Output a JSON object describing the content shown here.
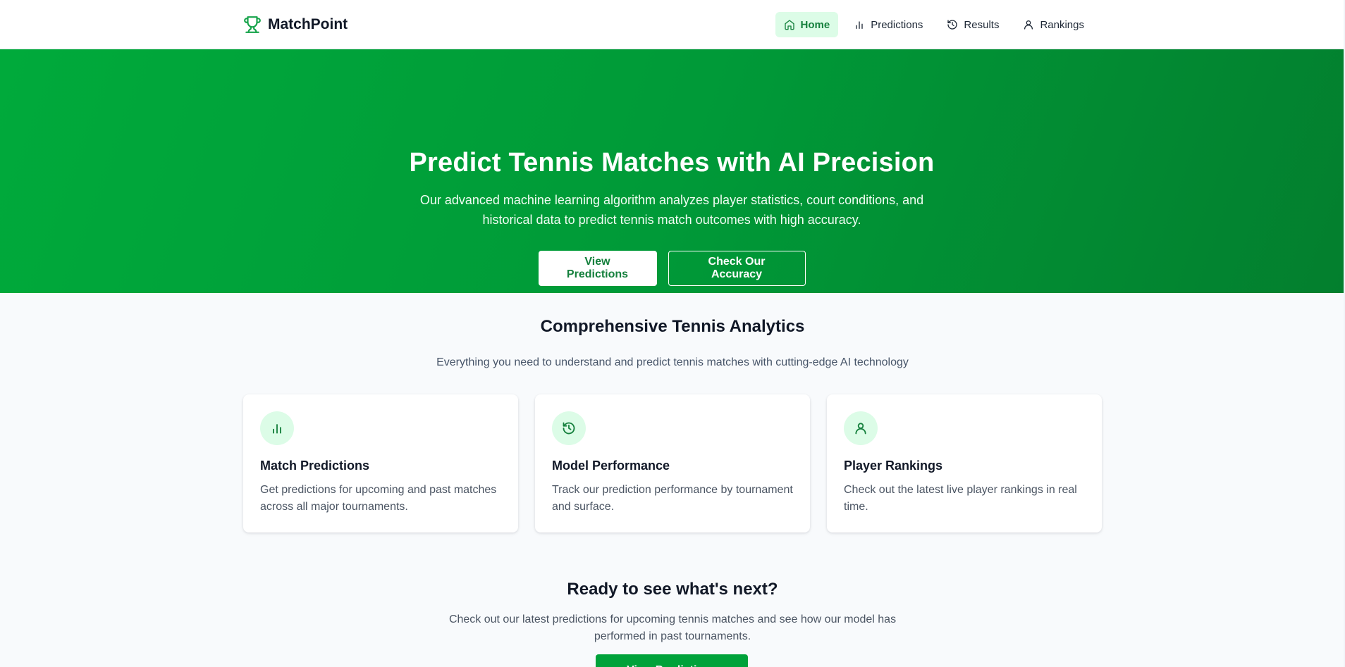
{
  "brand": {
    "name": "MatchPoint",
    "icon": "trophy-icon",
    "color": "#16a34a"
  },
  "nav": {
    "items": [
      {
        "label": "Home",
        "icon": "home-icon",
        "active": true
      },
      {
        "label": "Predictions",
        "icon": "bar-chart-icon",
        "active": false
      },
      {
        "label": "Results",
        "icon": "history-icon",
        "active": false
      },
      {
        "label": "Rankings",
        "icon": "user-icon",
        "active": false
      }
    ]
  },
  "hero": {
    "title": "Predict Tennis Matches with AI Precision",
    "text": "Our advanced machine learning algorithm analyzes player statistics, court conditions, and historical data to predict tennis match outcomes with high accuracy.",
    "primary_button": "View Predictions",
    "secondary_button": "Check Our Accuracy",
    "gradient": [
      "#00aa3b",
      "#037f2e"
    ]
  },
  "features": {
    "title": "Comprehensive Tennis Analytics",
    "subtitle": "Everything you need to understand and predict tennis matches with cutting-edge AI technology",
    "cards": [
      {
        "icon": "bar-chart-icon",
        "title": "Match Predictions",
        "text": "Get predictions for upcoming and past matches across all major tournaments."
      },
      {
        "icon": "history-icon",
        "title": "Model Performance",
        "text": "Track our prediction performance by tournament and surface."
      },
      {
        "icon": "user-icon",
        "title": "Player Rankings",
        "text": "Check out the latest live player rankings in real time."
      }
    ]
  },
  "cta": {
    "title": "Ready to see what's next?",
    "text": "Check out our latest predictions for upcoming tennis matches and see how our model has performed in past tournaments.",
    "button": "View Predictions"
  },
  "colors": {
    "accent": "#16a34a",
    "accent_soft": "#dcfce7",
    "background": "#f8fafc"
  }
}
